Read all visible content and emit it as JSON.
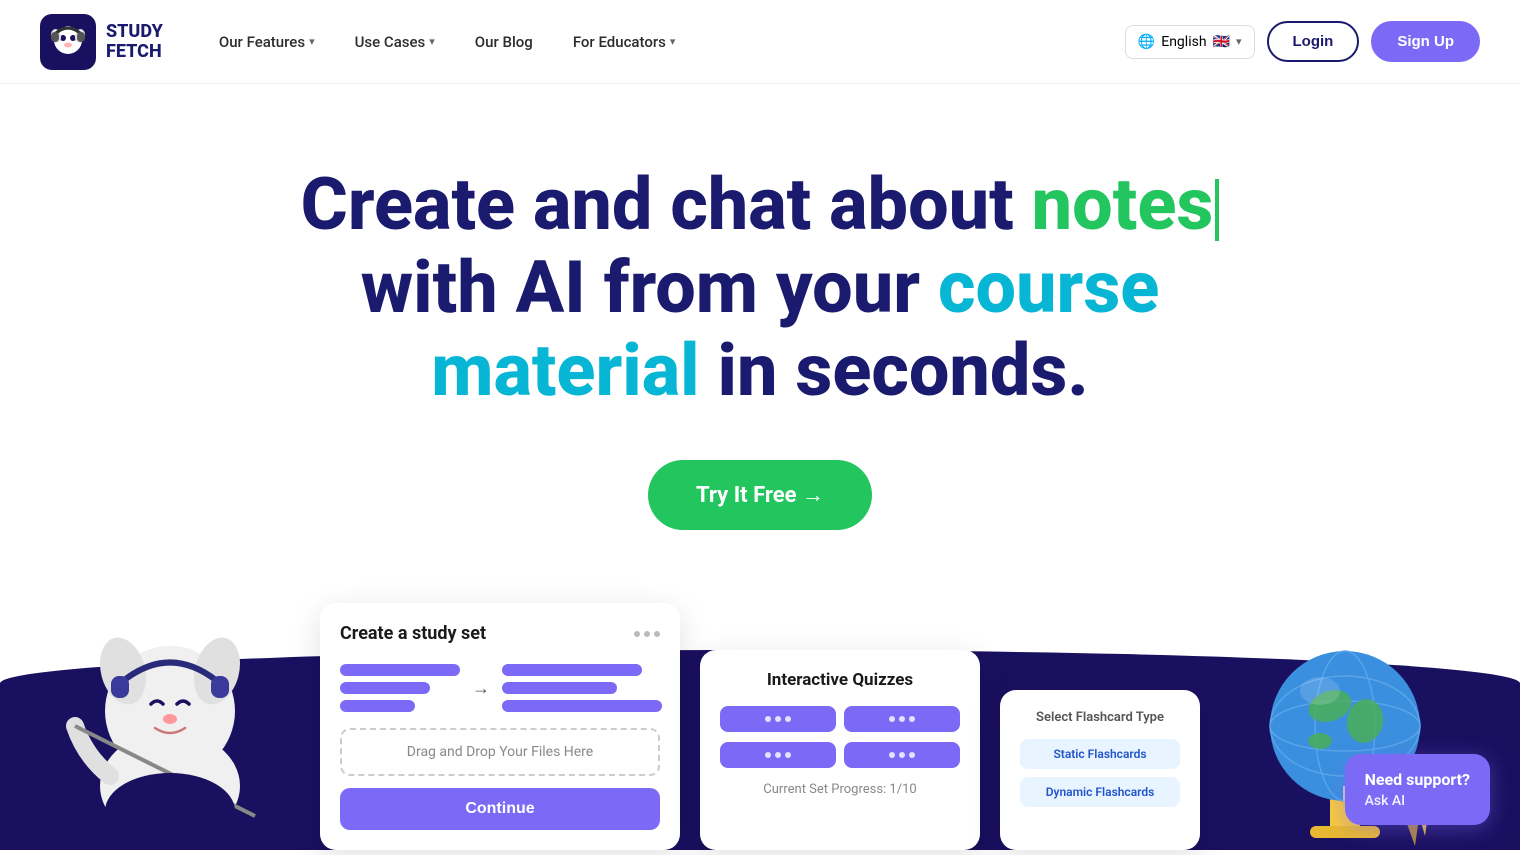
{
  "logo": {
    "line1": "STUDY",
    "line2": "FETCH"
  },
  "nav": {
    "features_label": "Our Features",
    "use_cases_label": "Use Cases",
    "blog_label": "Our Blog",
    "for_educators_label": "For Educators"
  },
  "lang": {
    "label": "English",
    "flag": "🌐"
  },
  "auth": {
    "login": "Login",
    "signup": "Sign Up"
  },
  "hero": {
    "title_part1": "Create and chat about ",
    "title_highlight1": "notes",
    "title_part2": " with AI from your ",
    "title_highlight2": "course material",
    "title_part3": " in seconds."
  },
  "cta": {
    "label": "Try It Free →"
  },
  "study_card": {
    "title": "Create a study set",
    "drag_text": "Drag and Drop Your Files Here",
    "continue": "Continue"
  },
  "quiz_card": {
    "title": "Interactive Quizzes",
    "progress": "Current Set Progress:  1/10"
  },
  "flashcard_card": {
    "title": "Select Flashcard Type",
    "option1": "Static Flashcards",
    "option2": "Dynamic Flashcards"
  },
  "support": {
    "need": "Need support?",
    "ask": "Ask AI"
  }
}
